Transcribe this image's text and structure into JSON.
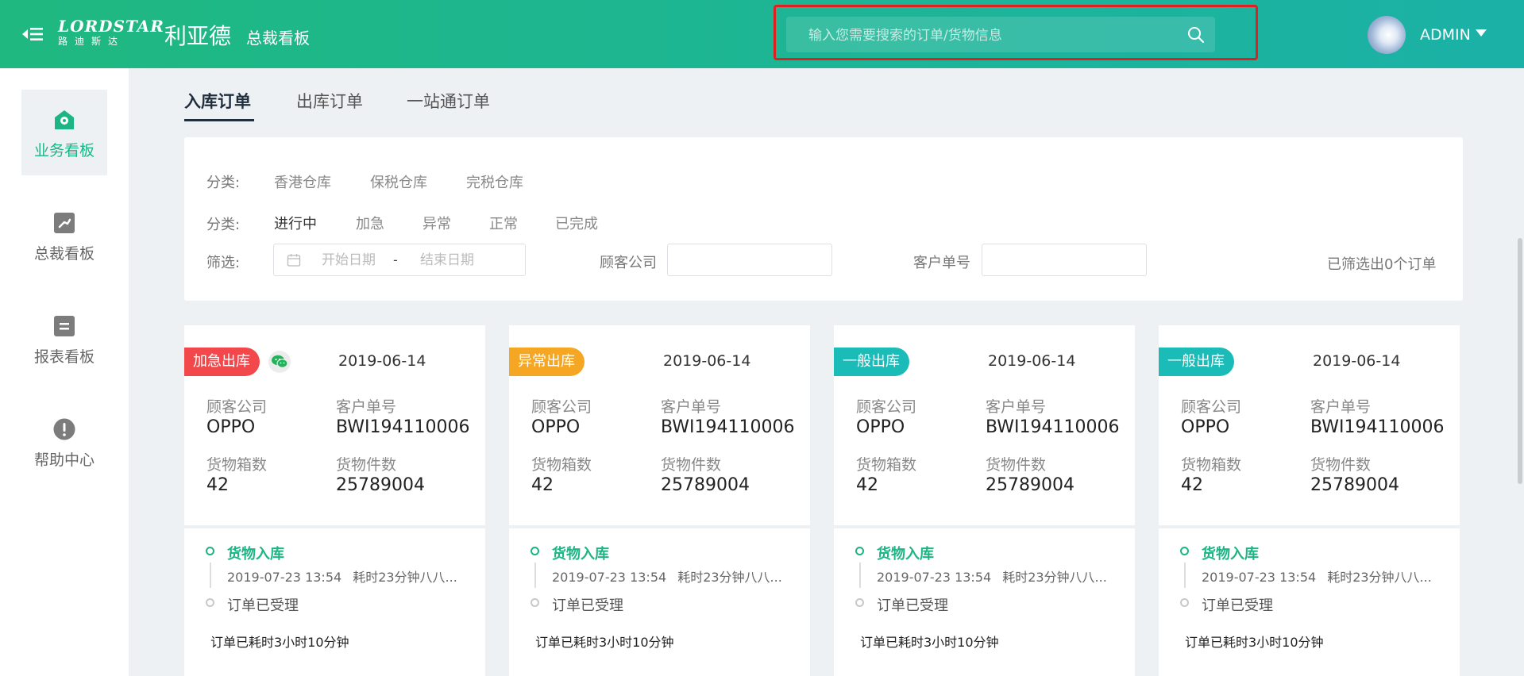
{
  "header": {
    "logo_line1": "LORDSTAR",
    "logo_line2": "路迪斯达",
    "brand": "利亚德",
    "sub_brand": "总裁看板",
    "search_placeholder": "输入您需要搜索的订单/货物信息",
    "user_name": "ADMIN",
    "accent_color": "#1db584",
    "highlight_color": "#e02020"
  },
  "sidebar": {
    "items": [
      {
        "label": "业务看板",
        "icon": "location-pin-icon",
        "active": true
      },
      {
        "label": "总裁看板",
        "icon": "trend-chart-icon",
        "active": false
      },
      {
        "label": "报表看板",
        "icon": "document-icon",
        "active": false
      },
      {
        "label": "帮助中心",
        "icon": "help-exclamation-icon",
        "active": false
      }
    ]
  },
  "tabs": [
    {
      "label": "入库订单",
      "active": true
    },
    {
      "label": "出库订单",
      "active": false
    },
    {
      "label": "一站通订单",
      "active": false
    }
  ],
  "filters": {
    "category_label": "分类:",
    "warehouse_options": [
      "香港仓库",
      "保税仓库",
      "完税仓库"
    ],
    "status_label": "分类:",
    "status_options": [
      "进行中",
      "加急",
      "异常",
      "正常",
      "已完成"
    ],
    "selected_status": "进行中",
    "filter_label": "筛选:",
    "start_date_placeholder": "开始日期",
    "date_separator": "-",
    "end_date_placeholder": "结束日期",
    "customer_company_label": "顾客公司",
    "customer_company_value": "",
    "customer_order_label": "客户单号",
    "customer_order_value": "",
    "result_text": "已筛选出0个订单"
  },
  "cards": [
    {
      "badge": "加急出库",
      "badge_color": "#f2474b",
      "has_wechat": true,
      "date": "2019-06-14",
      "company_label": "顾客公司",
      "company": "OPPO",
      "order_label": "客户单号",
      "order_no": "BWI194110006",
      "boxes_label": "货物箱数",
      "boxes": "42",
      "pieces_label": "货物件数",
      "pieces": "25789004",
      "timeline_title": "货物入库",
      "timeline_time": "2019-07-23 13:54",
      "timeline_duration": "耗时23分钟八八...",
      "timeline_status": "订单已受理",
      "elapsed": "订单已耗时3小时10分钟"
    },
    {
      "badge": "异常出库",
      "badge_color": "#f5a623",
      "has_wechat": false,
      "date": "2019-06-14",
      "company_label": "顾客公司",
      "company": "OPPO",
      "order_label": "客户单号",
      "order_no": "BWI194110006",
      "boxes_label": "货物箱数",
      "boxes": "42",
      "pieces_label": "货物件数",
      "pieces": "25789004",
      "timeline_title": "货物入库",
      "timeline_time": "2019-07-23 13:54",
      "timeline_duration": "耗时23分钟八八...",
      "timeline_status": "订单已受理",
      "elapsed": "订单已耗时3小时10分钟"
    },
    {
      "badge": "一般出库",
      "badge_color": "#1bbcb7",
      "has_wechat": false,
      "date": "2019-06-14",
      "company_label": "顾客公司",
      "company": "OPPO",
      "order_label": "客户单号",
      "order_no": "BWI194110006",
      "boxes_label": "货物箱数",
      "boxes": "42",
      "pieces_label": "货物件数",
      "pieces": "25789004",
      "timeline_title": "货物入库",
      "timeline_time": "2019-07-23 13:54",
      "timeline_duration": "耗时23分钟八八...",
      "timeline_status": "订单已受理",
      "elapsed": "订单已耗时3小时10分钟"
    },
    {
      "badge": "一般出库",
      "badge_color": "#1bbcb7",
      "has_wechat": false,
      "date": "2019-06-14",
      "company_label": "顾客公司",
      "company": "OPPO",
      "order_label": "客户单号",
      "order_no": "BWI194110006",
      "boxes_label": "货物箱数",
      "boxes": "42",
      "pieces_label": "货物件数",
      "pieces": "25789004",
      "timeline_title": "货物入库",
      "timeline_time": "2019-07-23 13:54",
      "timeline_duration": "耗时23分钟八八...",
      "timeline_status": "订单已受理",
      "elapsed": "订单已耗时3小时10分钟"
    }
  ]
}
